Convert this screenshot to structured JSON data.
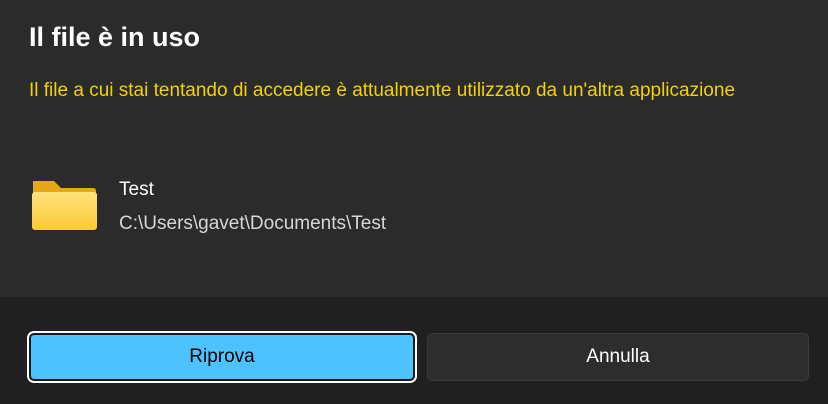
{
  "dialog": {
    "title": "Il file è in uso",
    "message": "Il file a cui stai tentando di accedere è attualmente utilizzato da un'altra applicazione",
    "message_color": "#f2d200",
    "file": {
      "icon": "folder-icon",
      "name": "Test",
      "path": "C:\\Users\\gavet\\Documents\\Test"
    }
  },
  "buttons": {
    "retry_label": "Riprova",
    "retry_color": "#4cc2ff",
    "cancel_label": "Annulla"
  }
}
